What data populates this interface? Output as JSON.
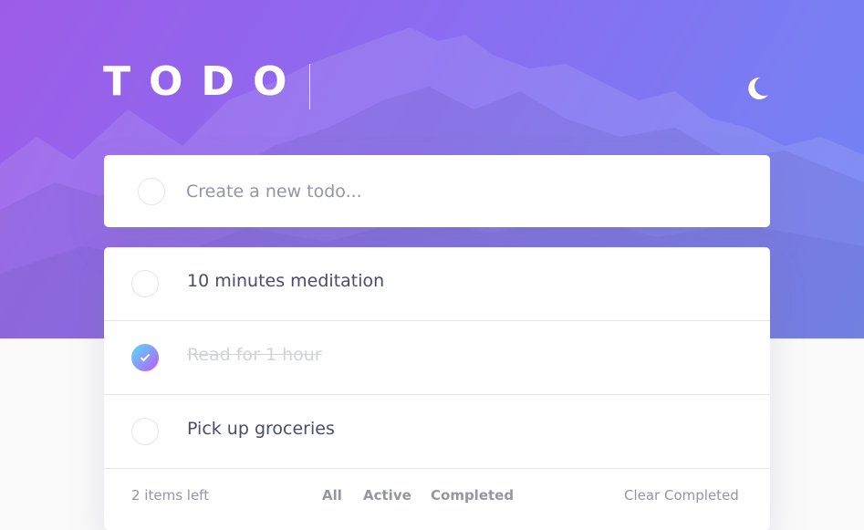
{
  "header": {
    "title": "TODO",
    "theme_icon": "moon-icon"
  },
  "new_todo": {
    "placeholder": "Create a new todo..."
  },
  "todos": [
    {
      "text": "10 minutes meditation",
      "completed": false
    },
    {
      "text": "Read for 1 hour",
      "completed": true
    },
    {
      "text": "Pick up groceries",
      "completed": false
    }
  ],
  "footer": {
    "items_left": "2 items left",
    "filters": {
      "all": "All",
      "active": "Active",
      "completed": "Completed"
    },
    "clear_completed": "Clear Completed"
  },
  "colors": {
    "gradient_start": "#55ddff",
    "gradient_end": "#c058f3",
    "hero_start": "#9d5ce8",
    "hero_end": "#6f86f3",
    "text": "#494c6b",
    "muted": "#9495a5"
  }
}
